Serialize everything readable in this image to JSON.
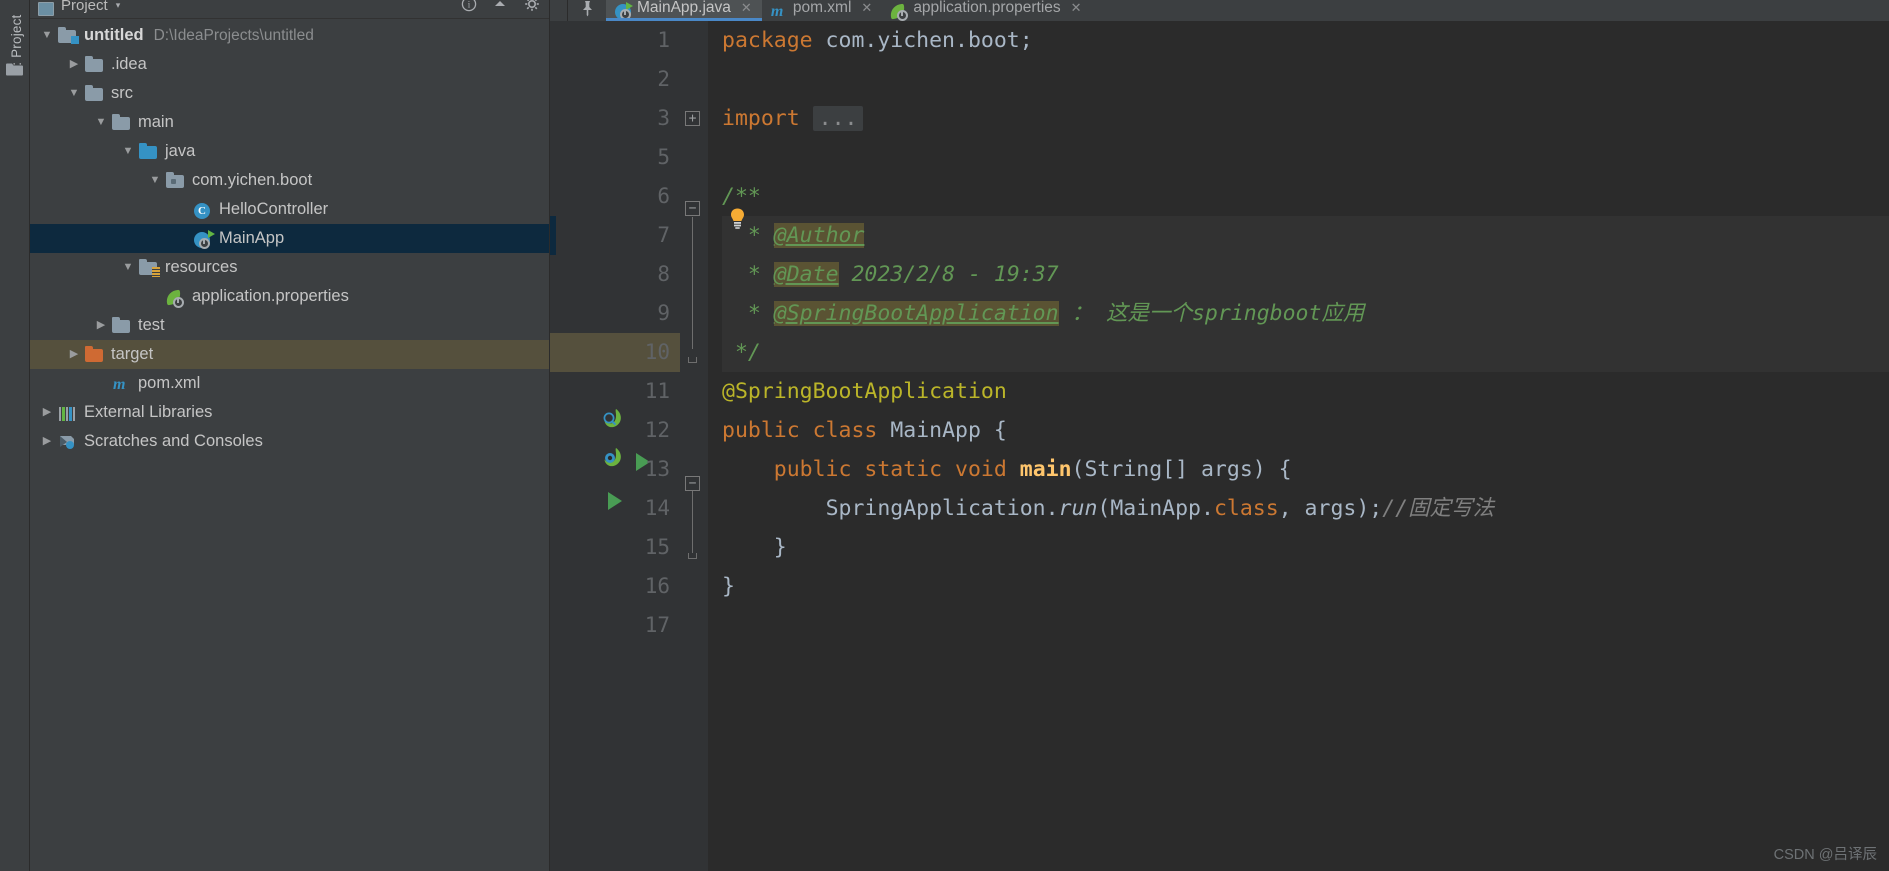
{
  "tool_strip": {
    "tab_label": "1: Project",
    "folder_icon": "folder-icon"
  },
  "project_panel": {
    "header": {
      "title": "Project",
      "caret": "▾",
      "icon": "project-view-icon",
      "actions": [
        "help-icon",
        "collapse-icon",
        "settings-icon"
      ]
    },
    "tree": [
      {
        "label": "untitled",
        "sub": "D:\\IdeaProjects\\untitled",
        "twisty": "▼",
        "indent": 0,
        "icon": "module-folder-icon",
        "bold": true,
        "state": "normal"
      },
      {
        "label": ".idea",
        "sub": "",
        "twisty": "▶",
        "indent": 1,
        "icon": "folder-icon",
        "bold": false,
        "state": "normal"
      },
      {
        "label": "src",
        "sub": "",
        "twisty": "▼",
        "indent": 1,
        "icon": "folder-icon",
        "bold": false,
        "state": "normal"
      },
      {
        "label": "main",
        "sub": "",
        "twisty": "▼",
        "indent": 2,
        "icon": "folder-icon",
        "bold": false,
        "state": "normal"
      },
      {
        "label": "java",
        "sub": "",
        "twisty": "▼",
        "indent": 3,
        "icon": "source-folder-icon",
        "bold": false,
        "state": "normal"
      },
      {
        "label": "com.yichen.boot",
        "sub": "",
        "twisty": "▼",
        "indent": 4,
        "icon": "package-icon",
        "bold": false,
        "state": "normal"
      },
      {
        "label": "HelloController",
        "sub": "",
        "twisty": "",
        "indent": 5,
        "icon": "java-class-icon",
        "bold": false,
        "state": "normal"
      },
      {
        "label": "MainApp",
        "sub": "",
        "twisty": "",
        "indent": 5,
        "icon": "spring-boot-class-icon",
        "bold": false,
        "state": "selected"
      },
      {
        "label": "resources",
        "sub": "",
        "twisty": "▼",
        "indent": 3,
        "icon": "resources-folder-icon",
        "bold": false,
        "state": "normal"
      },
      {
        "label": "application.properties",
        "sub": "",
        "twisty": "",
        "indent": 4,
        "icon": "spring-properties-icon",
        "bold": false,
        "state": "normal"
      },
      {
        "label": "test",
        "sub": "",
        "twisty": "▶",
        "indent": 2,
        "icon": "folder-icon",
        "bold": false,
        "state": "normal"
      },
      {
        "label": "target",
        "sub": "",
        "twisty": "▶",
        "indent": 1,
        "icon": "excluded-folder-icon",
        "bold": false,
        "state": "marked"
      },
      {
        "label": "pom.xml",
        "sub": "",
        "twisty": "",
        "indent": 2,
        "icon": "maven-icon",
        "bold": false,
        "state": "normal"
      },
      {
        "label": "External Libraries",
        "sub": "",
        "twisty": "▶",
        "indent": 0,
        "icon": "libraries-icon",
        "bold": false,
        "state": "normal"
      },
      {
        "label": "Scratches and Consoles",
        "sub": "",
        "twisty": "▶",
        "indent": 0,
        "icon": "scratches-icon",
        "bold": false,
        "state": "normal"
      }
    ]
  },
  "editor": {
    "tabs": [
      {
        "label": "MainApp.java",
        "icon": "spring-boot-class-icon",
        "active": true,
        "close": "✕"
      },
      {
        "label": "pom.xml",
        "icon": "maven-icon",
        "active": false,
        "close": "✕"
      },
      {
        "label": "application.properties",
        "icon": "spring-properties-icon",
        "active": false,
        "close": "✕"
      }
    ],
    "pin_icon": "pin-icon",
    "line_numbers": [
      "1",
      "2",
      "3",
      "5",
      "6",
      "7",
      "8",
      "9",
      "10",
      "11",
      "12",
      "13",
      "14",
      "15",
      "16",
      "17"
    ],
    "gutter_icons": {
      "line11": "spring-bean-icon",
      "line12": "spring-run-icon",
      "line12b": "run-triangle-icon",
      "line13": "run-triangle-icon"
    },
    "code": {
      "l1": {
        "kw": "package",
        "rest": " com.yichen.boot;"
      },
      "l3": {
        "kw": "import",
        "ellipsis": "..."
      },
      "l6": "/**",
      "l7": {
        "star": "*",
        "tag": "@Author",
        "text": ""
      },
      "l8": {
        "star": "*",
        "tag": "@Date",
        "text": "2023/2/8 - 19:37"
      },
      "l9": {
        "star": "*",
        "tag": "@SpringBootApplication",
        "text": "： 这是一个springboot应用"
      },
      "l10": "*/",
      "l11": "@SpringBootApplication",
      "l12": {
        "kw1": "public",
        "kw2": "class",
        "name": "MainApp",
        "brace": "{"
      },
      "l13": {
        "kw1": "public",
        "kw2": "static",
        "kw3": "void",
        "name": "main",
        "params": "(String[] args)",
        "brace": "{"
      },
      "l14": {
        "cls": "SpringApplication",
        "dot": ".",
        "mth": "run",
        "args": "(MainApp",
        "dot2": ".",
        "kw": "class",
        "rest": ", args);",
        "comment": "//固定写法"
      },
      "l15": "}",
      "l16": "}"
    },
    "bulb_icon": "intention-bulb-icon",
    "watermark": "CSDN @吕译辰"
  },
  "colors": {
    "panel_bg": "#3c3f41",
    "editor_bg": "#2b2b2b",
    "gutter_bg": "#313335",
    "selection_blue": "#0d293e",
    "marked_brown": "#55503d",
    "tab_active": "#4e5254",
    "tab_underline": "#4a88c7",
    "keyword_orange": "#cc7832",
    "comment_green": "#629755",
    "annotation_yellow": "#bbb529",
    "method_yellow": "#ffc66d",
    "text_grey": "#a9b7c6",
    "folder_blue": "#3592c4",
    "folder_orange": "#cf6a33",
    "spring_green": "#6cb33f"
  }
}
